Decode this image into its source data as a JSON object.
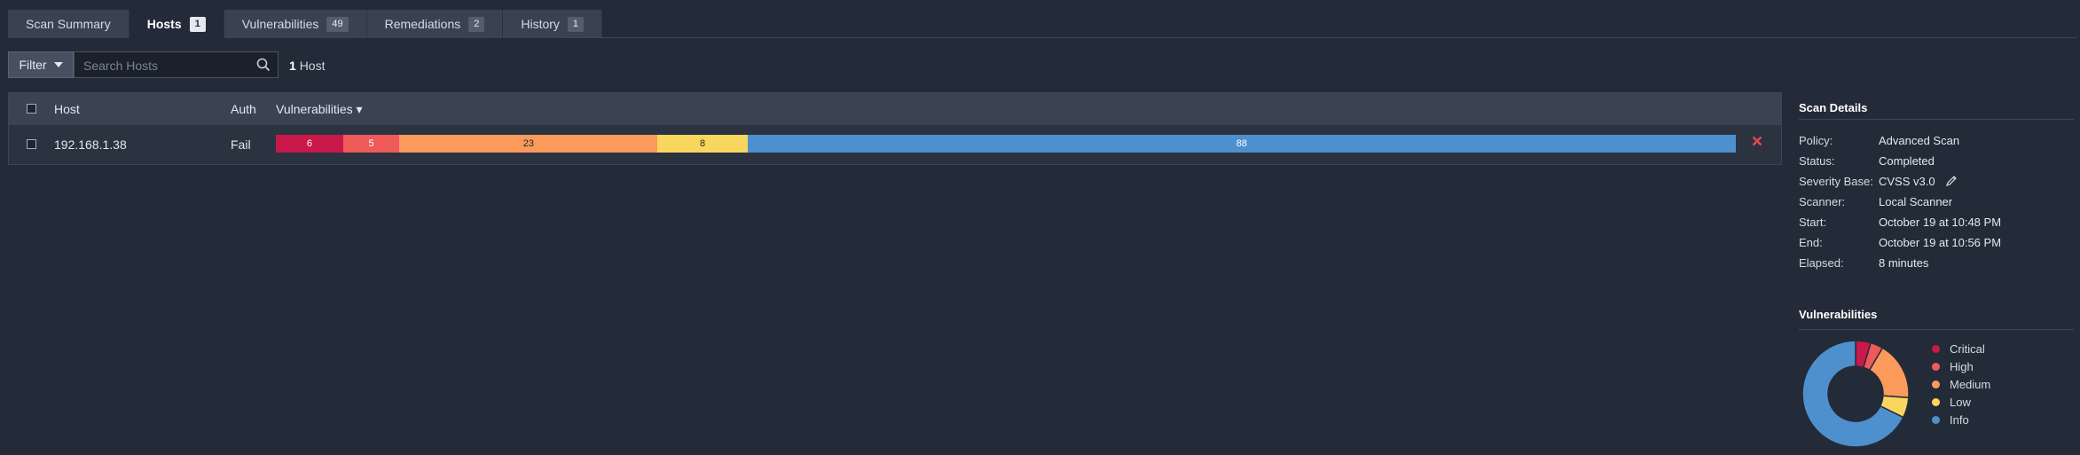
{
  "tabs": [
    {
      "label": "Scan Summary",
      "badge": ""
    },
    {
      "label": "Hosts",
      "badge": "1",
      "active": true
    },
    {
      "label": "Vulnerabilities",
      "badge": "49"
    },
    {
      "label": "Remediations",
      "badge": "2"
    },
    {
      "label": "History",
      "badge": "1"
    }
  ],
  "filter": {
    "label": "Filter",
    "search_placeholder": "Search Hosts"
  },
  "host_count": {
    "number": "1",
    "label": "Host"
  },
  "table": {
    "headers": {
      "host": "Host",
      "auth": "Auth",
      "vulnerabilities": "Vulnerabilities ▾"
    },
    "rows": [
      {
        "host": "192.168.1.38",
        "auth": "Fail",
        "counts": [
          {
            "severity": "Critical",
            "value": 6,
            "color": "#c9184a"
          },
          {
            "severity": "High",
            "value": 5,
            "color": "#ee5a5a"
          },
          {
            "severity": "Medium",
            "value": 23,
            "color": "#fb9a5b"
          },
          {
            "severity": "Low",
            "value": 8,
            "color": "#f9d65e"
          },
          {
            "severity": "Info",
            "value": 88,
            "color": "#4d90cd"
          }
        ]
      }
    ]
  },
  "scan_details": {
    "title": "Scan Details",
    "rows": [
      {
        "label": "Policy:",
        "value": "Advanced Scan"
      },
      {
        "label": "Status:",
        "value": "Completed"
      },
      {
        "label": "Severity Base:",
        "value": "CVSS v3.0"
      },
      {
        "label": "Scanner:",
        "value": "Local Scanner"
      },
      {
        "label": "Start:",
        "value": "October 19 at 10:48 PM"
      },
      {
        "label": "End:",
        "value": "October 19 at 10:56 PM"
      },
      {
        "label": "Elapsed:",
        "value": "8 minutes"
      }
    ]
  },
  "vulnerabilities_panel": {
    "title": "Vulnerabilities",
    "legend": [
      {
        "label": "Critical",
        "color": "#c9184a"
      },
      {
        "label": "High",
        "color": "#ee5a5a"
      },
      {
        "label": "Medium",
        "color": "#fb9a5b"
      },
      {
        "label": "Low",
        "color": "#f9d65e"
      },
      {
        "label": "Info",
        "color": "#4d90cd"
      }
    ]
  },
  "chart_data": {
    "type": "pie",
    "categories": [
      "Critical",
      "High",
      "Medium",
      "Low",
      "Info"
    ],
    "values": [
      6,
      5,
      23,
      8,
      88
    ],
    "title": "Vulnerabilities"
  }
}
